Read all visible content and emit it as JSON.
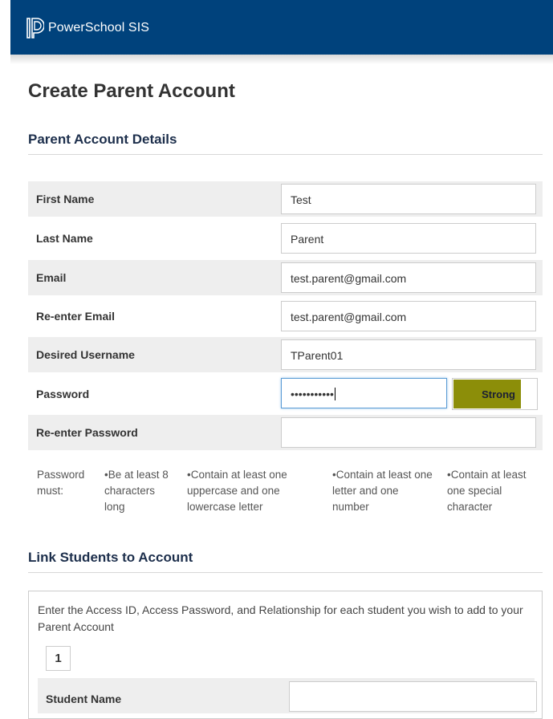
{
  "header": {
    "app_title": "PowerSchool SIS",
    "logo_icon": "powerschool-logo-icon",
    "background": "#00427c"
  },
  "page": {
    "title": "Create Parent Account"
  },
  "account_section": {
    "title": "Parent Account Details",
    "fields": [
      {
        "label": "First Name",
        "value": "Test"
      },
      {
        "label": "Last Name",
        "value": "Parent"
      },
      {
        "label": "Email",
        "value": "test.parent@gmail.com"
      },
      {
        "label": "Re-enter Email",
        "value": "test.parent@gmail.com"
      },
      {
        "label": "Desired Username",
        "value": "TParent01"
      },
      {
        "label": "Password",
        "value": "•••••••••••"
      },
      {
        "label": "Re-enter Password",
        "value": ""
      }
    ],
    "password_strength": {
      "label": "Strong",
      "color": "#8c8e09",
      "level": 0.8
    },
    "password_rules": {
      "intro": "Password must:",
      "rules": [
        "•Be at least 8 characters long",
        "•Contain at least one uppercase and one lowercase letter",
        "•Contain at least one letter and one number",
        "•Contain at least one special character"
      ]
    }
  },
  "link_section": {
    "title": "Link Students to Account",
    "instructions": "Enter the Access ID, Access Password, and Relationship for each student you wish to add to your Parent Account",
    "student_number": "1",
    "student_name_label": "Student Name",
    "student_name_value": ""
  }
}
